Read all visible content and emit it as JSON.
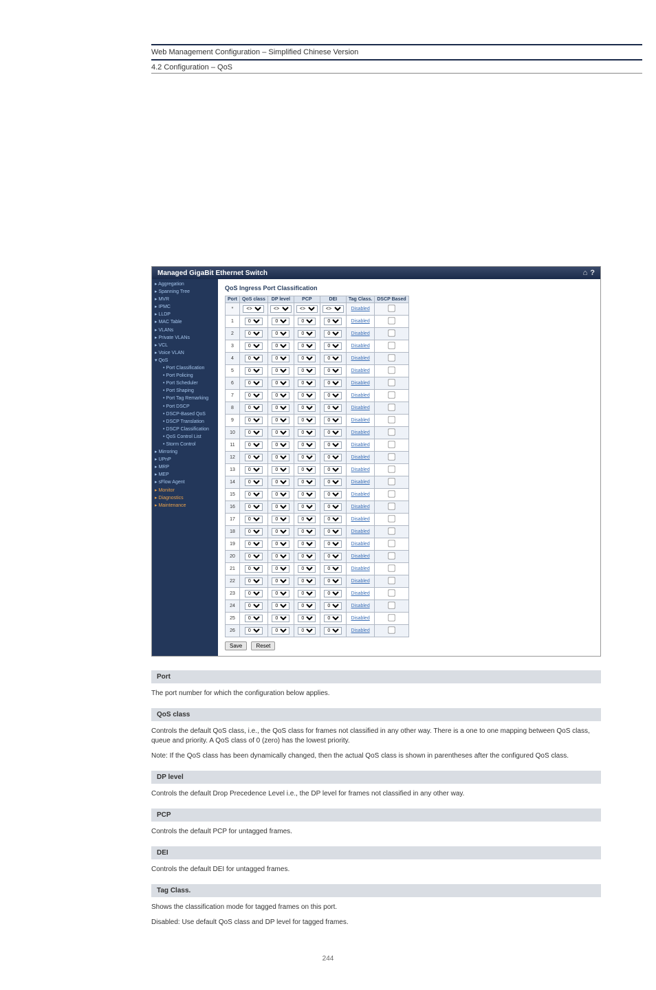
{
  "header": {
    "line1": "Web Management Configuration – Simplified Chinese Version",
    "line2": "4.2 Configuration – QoS"
  },
  "topbar": {
    "title": "Managed GigaBit Ethernet Switch",
    "icon_home": "⌂",
    "icon_help": "?"
  },
  "sidebar": {
    "items": [
      {
        "label": "▸ Aggregation",
        "cls": "item open"
      },
      {
        "label": "▸ Spanning Tree",
        "cls": "item open"
      },
      {
        "label": "▸ MVR",
        "cls": "item open"
      },
      {
        "label": "▸ IPMC",
        "cls": "item open"
      },
      {
        "label": "▸ LLDP",
        "cls": "item open"
      },
      {
        "label": "▸ MAC Table",
        "cls": "item open"
      },
      {
        "label": "▸ VLANs",
        "cls": "item open"
      },
      {
        "label": "▸ Private VLANs",
        "cls": "item open"
      },
      {
        "label": "▸ VCL",
        "cls": "item open"
      },
      {
        "label": "▸ Voice VLAN",
        "cls": "item open"
      },
      {
        "label": "▾ QoS",
        "cls": "item open"
      },
      {
        "label": "• Port Classification",
        "cls": "item sub2"
      },
      {
        "label": "• Port Policing",
        "cls": "item sub2"
      },
      {
        "label": "• Port Scheduler",
        "cls": "item sub2"
      },
      {
        "label": "• Port Shaping",
        "cls": "item sub2"
      },
      {
        "label": "• Port Tag Remarking",
        "cls": "item sub2"
      },
      {
        "label": "• Port DSCP",
        "cls": "item sub2"
      },
      {
        "label": "• DSCP-Based QoS",
        "cls": "item sub2"
      },
      {
        "label": "• DSCP Translation",
        "cls": "item sub2"
      },
      {
        "label": "• DSCP Classification",
        "cls": "item sub2"
      },
      {
        "label": "• QoS Control List",
        "cls": "item sub2"
      },
      {
        "label": "• Storm Control",
        "cls": "item sub2"
      },
      {
        "label": "▸ Mirroring",
        "cls": "item open"
      },
      {
        "label": "▸ UPnP",
        "cls": "item open"
      },
      {
        "label": "▸ MRP",
        "cls": "item open"
      },
      {
        "label": "▸ MEP",
        "cls": "item open"
      },
      {
        "label": "▸ sFlow Agent",
        "cls": "item open"
      },
      {
        "label": "▸ Monitor",
        "cls": "item orange"
      },
      {
        "label": "▸ Diagnostics",
        "cls": "item orange"
      },
      {
        "label": "▸ Maintenance",
        "cls": "item orange"
      }
    ]
  },
  "page": {
    "title": "QoS Ingress Port Classification",
    "columns": [
      "Port",
      "QoS class",
      "DP level",
      "PCP",
      "DEI",
      "Tag Class.",
      "DSCP Based"
    ],
    "wild_label": "*",
    "sel_wild": "<>",
    "sel_val": "0",
    "tag_disabled": "Disabled",
    "rows": [
      1,
      2,
      3,
      4,
      5,
      6,
      7,
      8,
      9,
      10,
      11,
      12,
      13,
      14,
      15,
      16,
      17,
      18,
      19,
      20,
      21,
      22,
      23,
      24,
      25,
      26
    ],
    "save": "Save",
    "reset": "Reset"
  },
  "desc": {
    "s1": "Port",
    "p1": "The port number for which the configuration below applies.",
    "s2": "QoS class",
    "p2a": "Controls the default QoS class, i.e., the QoS class for frames not classified in any other way. There is a one to one mapping between QoS class, queue and priority. A QoS class of 0 (zero) has the lowest priority.",
    "p2b": "Note: If the QoS class has been dynamically changed, then the actual QoS class is shown in parentheses after the configured QoS class.",
    "s3": "DP level",
    "p3": "Controls the default Drop Precedence Level i.e., the DP level for frames not classified in any other way.",
    "s4": "PCP",
    "p4": "Controls the default PCP for untagged frames.",
    "s5": "DEI",
    "p5": "Controls the default DEI for untagged frames.",
    "s6": "Tag Class.",
    "p6a": "Shows the classification mode for tagged frames on this port.",
    "p6b": "Disabled: Use default QoS class and DP level for tagged frames."
  },
  "footer": "244"
}
